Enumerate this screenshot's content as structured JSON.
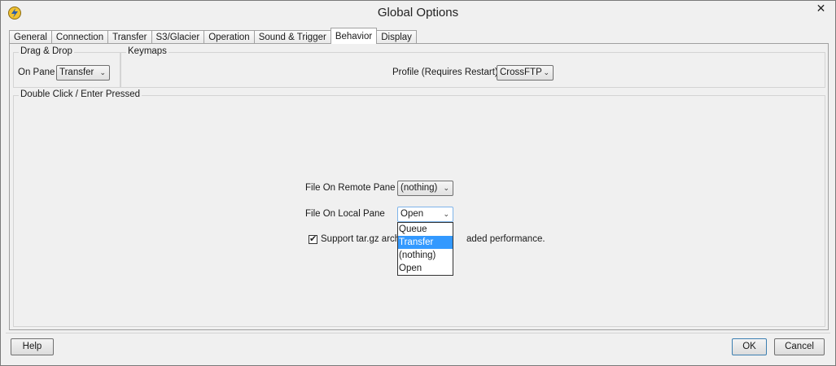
{
  "window": {
    "title": "Global Options",
    "close_glyph": "✕"
  },
  "tabs": [
    {
      "label": "General"
    },
    {
      "label": "Connection"
    },
    {
      "label": "Transfer"
    },
    {
      "label": "S3/Glacier"
    },
    {
      "label": "Operation"
    },
    {
      "label": "Sound & Trigger"
    },
    {
      "label": "Behavior",
      "active": true
    },
    {
      "label": "Display"
    }
  ],
  "drag_drop": {
    "group_label": "Drag & Drop",
    "on_pane_label": "On Pane",
    "on_pane_value": "Transfer"
  },
  "keymaps": {
    "group_label": "Keymaps",
    "profile_label": "Profile (Requires Restart)",
    "profile_value": "CrossFTP"
  },
  "double_click": {
    "group_label": "Double Click / Enter Pressed",
    "remote_label": "File On Remote Pane",
    "remote_value": "(nothing)",
    "local_label": "File On Local Pane",
    "local_value": "Open",
    "local_options": [
      "Queue",
      "Transfer",
      "(nothing)",
      "Open"
    ],
    "local_highlighted": "Transfer",
    "support_label_left": "Support tar.gz arch",
    "support_label_right": "aded performance.",
    "support_checked": true
  },
  "buttons": {
    "help": "Help",
    "ok": "OK",
    "cancel": "Cancel"
  },
  "icons": {
    "app": "lightning-app-icon",
    "arrow": "chevron-down-icon",
    "check": "checkmark-icon"
  },
  "colors": {
    "selection": "#3399ff",
    "window_bg": "#f0f0f0"
  }
}
